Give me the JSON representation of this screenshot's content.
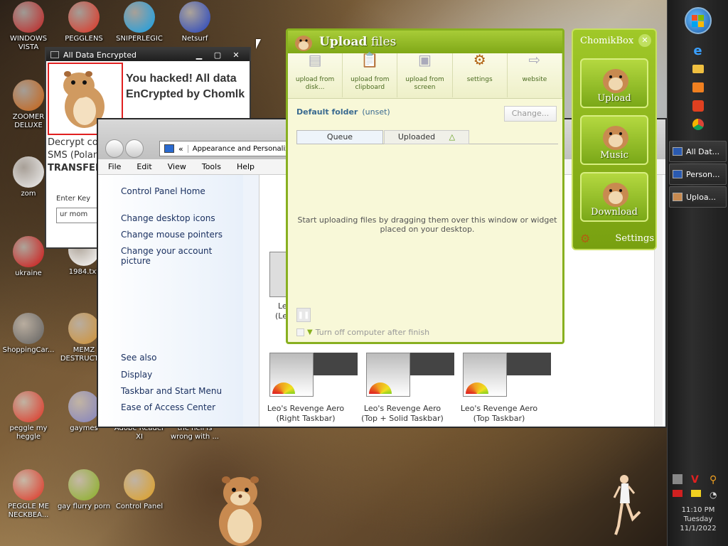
{
  "desktop_icons": [
    {
      "label": "WINDOWS VISTA",
      "icon": "vista-icon",
      "color": "#c02020"
    },
    {
      "label": "PEGGLENS",
      "icon": "peggle-icon",
      "color": "#e03020"
    },
    {
      "label": "SNIPERLEGIC",
      "icon": "skype-icon",
      "color": "#10a0e8"
    },
    {
      "label": "Netsurf",
      "icon": "globe-icon",
      "color": "#2040c0"
    },
    {
      "label": "ZOOMER DELUXE",
      "icon": "zuma-icon",
      "color": "#c86010"
    },
    {
      "label": "zom",
      "icon": "flower-icon",
      "color": "#f0f0f0"
    },
    {
      "label": "ukraine",
      "icon": "radiation-icon",
      "color": "#d01010"
    },
    {
      "label": "1984.txt",
      "icon": "text-file-icon",
      "color": "#ffffff"
    },
    {
      "label": "ShoppingCar...",
      "icon": "flash-icon",
      "color": "#606060"
    },
    {
      "label": "MEMZ DESTRUCTI...",
      "icon": "memz-icon",
      "color": "#d09030"
    },
    {
      "label": "peggle my heggle",
      "icon": "peggle-icon",
      "color": "#e03020"
    },
    {
      "label": "gaymes",
      "icon": "disc-icon",
      "color": "#8080c0"
    },
    {
      "label": "Adobe Reader XI",
      "icon": "adobe-icon",
      "color": "#b00000"
    },
    {
      "label": "the hell is wrong with ...",
      "icon": "blank-icon",
      "color": "#888888"
    },
    {
      "label": "PEGGLE ME NECKBEA...",
      "icon": "peggle-icon",
      "color": "#e03020"
    },
    {
      "label": "gay flurry porn",
      "icon": "hamster-box-icon",
      "color": "#88b020"
    },
    {
      "label": "Control Panel",
      "icon": "control-panel-icon",
      "color": "#e0a020"
    }
  ],
  "ransom_window": {
    "title": "All Data Encrypted",
    "message": "You hacked! All data EnCrypted by Chomlk",
    "decrypt_text_1": "Decrypt cos",
    "decrypt_text_2": "SMS (Polan",
    "decrypt_text_3": "TRANSFER",
    "key_label": "Enter Key",
    "key_value": "ur mom"
  },
  "control_panel": {
    "breadcrumb": "Appearance and Personaliz",
    "menu": [
      "File",
      "Edit",
      "View",
      "Tools",
      "Help"
    ],
    "sidebar_links": [
      "Control Panel Home",
      "Change desktop icons",
      "Change mouse pointers",
      "Change your account picture"
    ],
    "see_also_label": "See also",
    "see_also_links": [
      "Display",
      "Taskbar and Start Menu",
      "Ease of Access Center"
    ],
    "themes": [
      {
        "name": "Leo's Revenge Aero",
        "sub": "(Right Taskbar)"
      },
      {
        "name": "Leo's Revenge Aero",
        "sub": "(Top + Solid Taskbar)"
      },
      {
        "name": "Leo's Revenge Aero",
        "sub": "(Top Taskbar)"
      }
    ],
    "partial_theme": "Le",
    "partial_theme_sub": "(Le"
  },
  "upload_window": {
    "title_bold": "Upload",
    "title_rest": " files",
    "toolbar": [
      {
        "label": "upload from disk...",
        "icon": "disk-upload-icon"
      },
      {
        "label": "upload from clipboard",
        "icon": "clipboard-upload-icon"
      },
      {
        "label": "upload from screen",
        "icon": "screen-upload-icon"
      },
      {
        "label": "settings",
        "icon": "gear-icon"
      },
      {
        "label": "website",
        "icon": "website-icon"
      }
    ],
    "default_folder_label": "Default folder",
    "default_folder_value": "(unset)",
    "change_button": "Change...",
    "tabs": [
      "Queue",
      "Uploaded"
    ],
    "empty_message": "Start uploading files by dragging them over this window or widget placed on your desktop.",
    "shutdown_label": "Turn off computer after finish"
  },
  "chomikbox": {
    "title": "ChomikBox",
    "buttons": [
      "Upload",
      "Music",
      "Download"
    ],
    "settings_label": "Settings"
  },
  "taskbar": {
    "tasks": [
      {
        "label": "All Dat...",
        "icon": "window-icon"
      },
      {
        "label": "Person...",
        "icon": "personalize-icon"
      },
      {
        "label": "Uploa...",
        "icon": "hamster-icon"
      }
    ],
    "time": "11:10 PM",
    "day": "Tuesday",
    "date": "11/1/2022"
  }
}
